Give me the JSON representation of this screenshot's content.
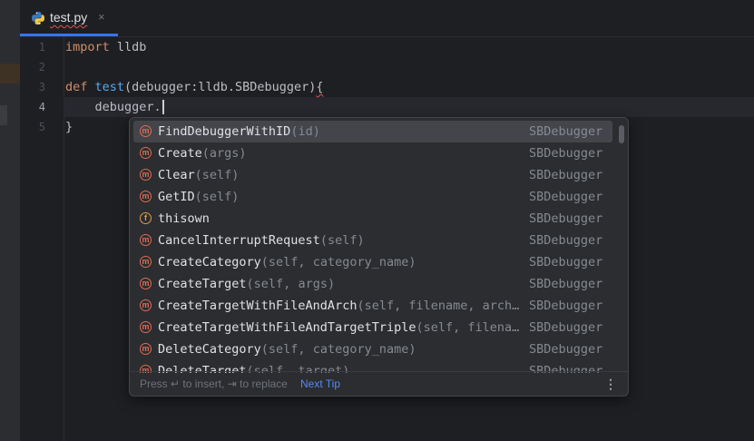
{
  "tab": {
    "title": "test.py",
    "close": "×"
  },
  "gutter": {
    "lines": [
      "1",
      "2",
      "3",
      "4",
      "5"
    ]
  },
  "code": {
    "line1": {
      "kw": "import",
      "rest": " lldb"
    },
    "line3": {
      "kw": "def",
      "fn": "test",
      "rest": "(debugger:lldb.SBDebugger)",
      "brace": "{"
    },
    "line4": {
      "indent": "    ",
      "text": "debugger."
    },
    "line5": {
      "text": "}"
    }
  },
  "completion": {
    "items": [
      {
        "kind": "m",
        "name": "FindDebuggerWithID",
        "args": "(id)",
        "type": "SBDebugger",
        "selected": true
      },
      {
        "kind": "m",
        "name": "Create",
        "args": "(args)",
        "type": "SBDebugger"
      },
      {
        "kind": "m",
        "name": "Clear",
        "args": "(self)",
        "type": "SBDebugger"
      },
      {
        "kind": "m",
        "name": "GetID",
        "args": "(self)",
        "type": "SBDebugger"
      },
      {
        "kind": "f",
        "name": "thisown",
        "args": "",
        "type": "SBDebugger"
      },
      {
        "kind": "m",
        "name": "CancelInterruptRequest",
        "args": "(self)",
        "type": "SBDebugger"
      },
      {
        "kind": "m",
        "name": "CreateCategory",
        "args": "(self, category_name)",
        "type": "SBDebugger"
      },
      {
        "kind": "m",
        "name": "CreateTarget",
        "args": "(self, args)",
        "type": "SBDebugger"
      },
      {
        "kind": "m",
        "name": "CreateTargetWithFileAndArch",
        "args": "(self, filename, arch…",
        "type": "SBDebugger"
      },
      {
        "kind": "m",
        "name": "CreateTargetWithFileAndTargetTriple",
        "args": "(self, filena…",
        "type": "SBDebugger"
      },
      {
        "kind": "m",
        "name": "DeleteCategory",
        "args": "(self, category_name)",
        "type": "SBDebugger"
      },
      {
        "kind": "m",
        "name": "DeleteTarget",
        "args": "(self, target)",
        "type": "SBDebugger"
      }
    ],
    "footer": {
      "hint": "Press ↵ to insert, ⇥ to replace",
      "next_tip": "Next Tip",
      "more": "⋮"
    }
  },
  "colors": {
    "accent": "#3574f0",
    "keyword": "#cf8e6d",
    "function": "#56a8f5",
    "method_badge": "#e06c56",
    "field_badge": "#e09a50",
    "link": "#548af7"
  },
  "icons": {
    "tab": "python-icon",
    "close": "close-icon",
    "method": "method-icon",
    "field": "field-icon",
    "more": "more-vertical-icon"
  }
}
